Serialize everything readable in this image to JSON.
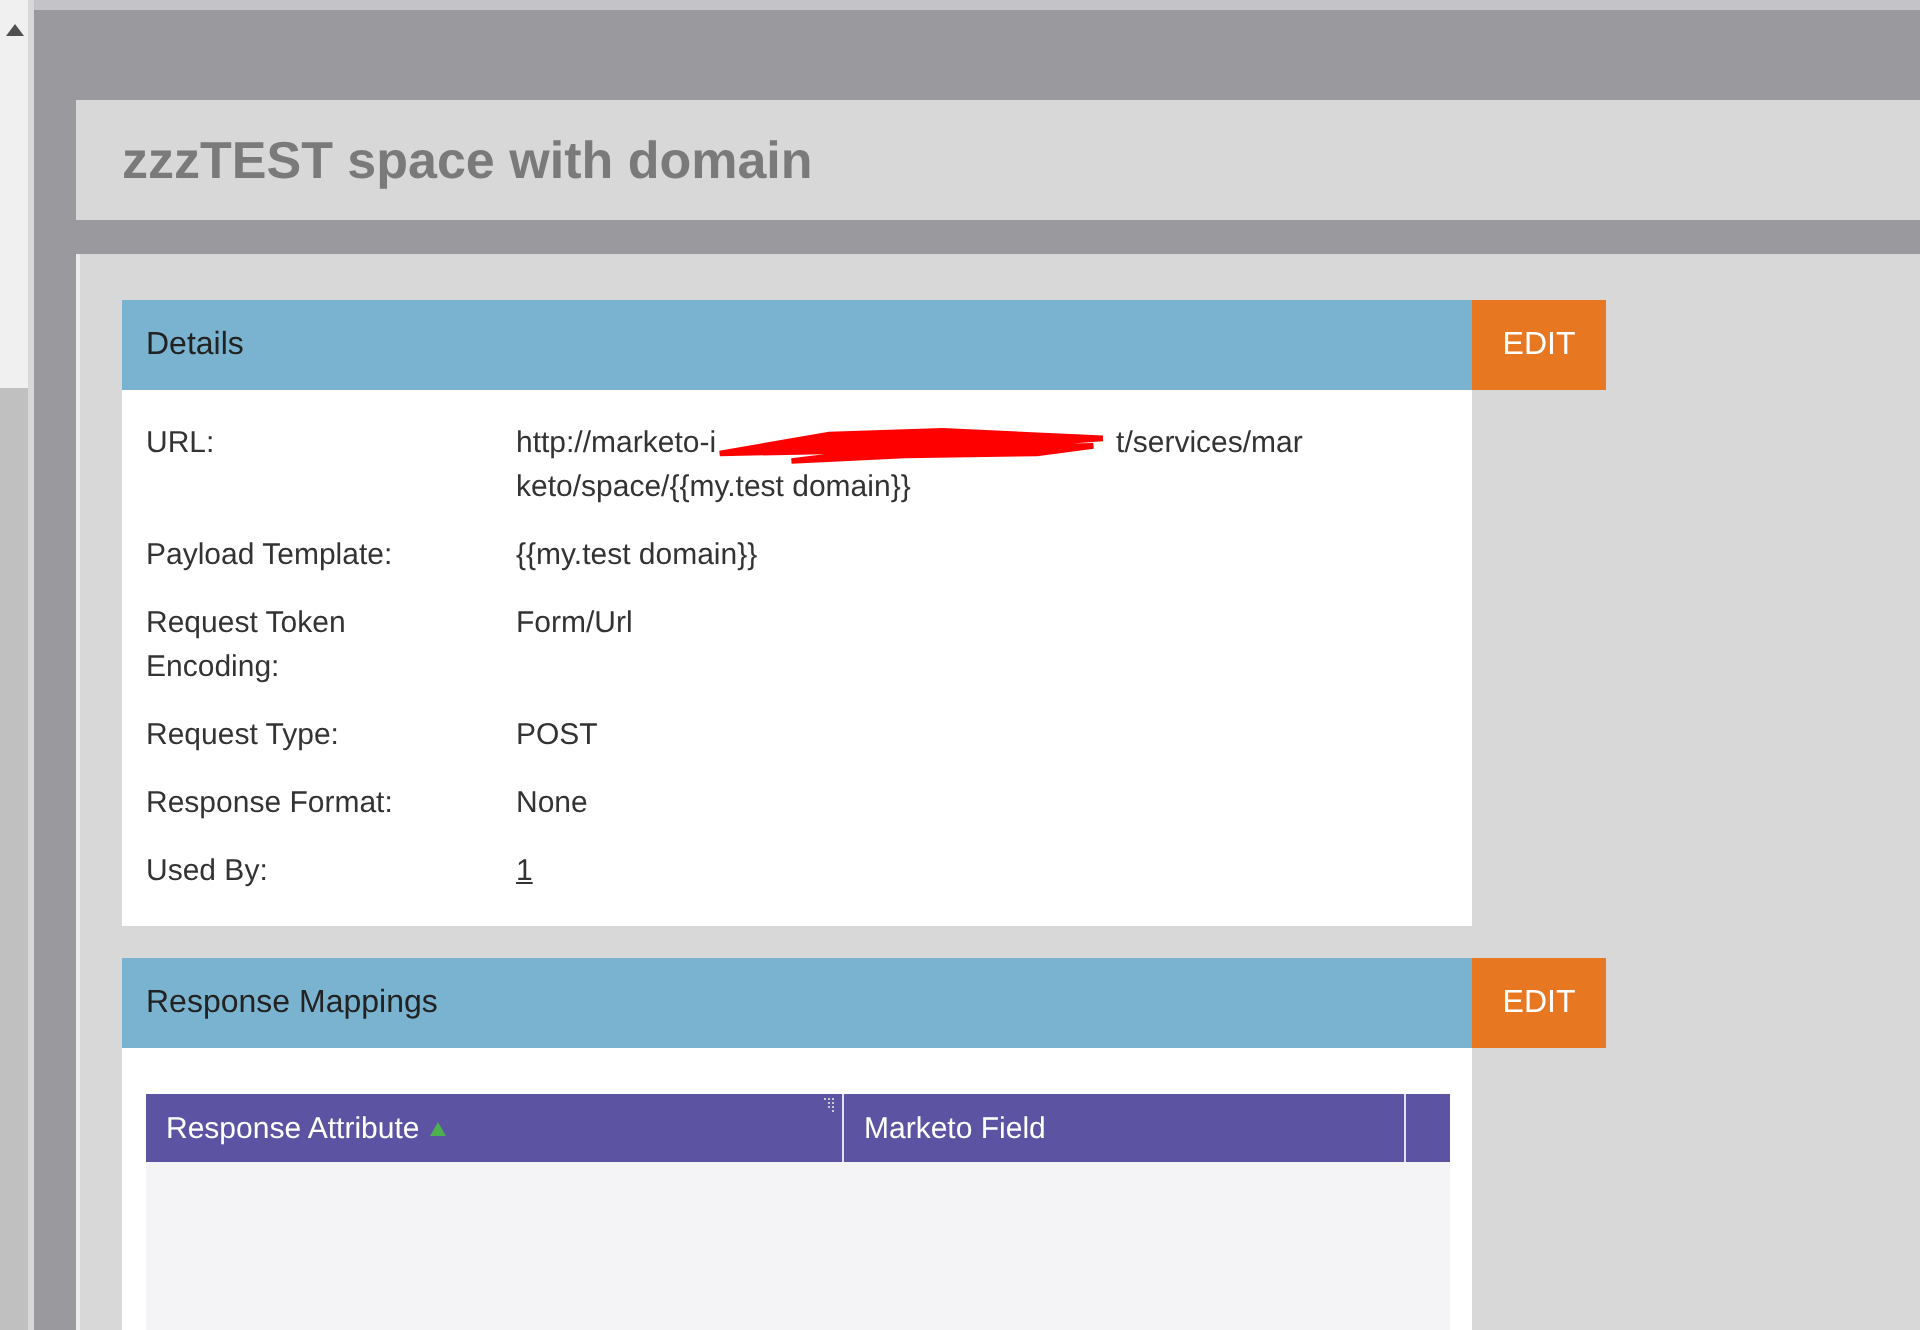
{
  "page_title": "zzzTEST space with domain",
  "details": {
    "title": "Details",
    "edit_button": "EDIT",
    "fields": [
      {
        "label": "URL:",
        "kind": "redacted",
        "value_start": "http://marketo-i",
        "value_middle": "t/services/mar",
        "value_line2": "keto/space/{{my.test domain}}"
      },
      {
        "label": "Payload Template:",
        "kind": "text",
        "value": "{{my.test domain}}"
      },
      {
        "label": "Request Token Encoding:",
        "kind": "text",
        "value": "Form/Url"
      },
      {
        "label": "Request Type:",
        "kind": "text",
        "value": "POST"
      },
      {
        "label": "Response Format:",
        "kind": "text",
        "value": "None"
      },
      {
        "label": "Used By:",
        "kind": "link",
        "value": "1"
      }
    ]
  },
  "response_mappings": {
    "title": "Response Mappings",
    "edit_button": "EDIT",
    "table": {
      "columns": [
        {
          "label": "Response Attribute",
          "sorted": true
        },
        {
          "label": "Marketo Field",
          "sorted": false
        }
      ]
    }
  }
}
